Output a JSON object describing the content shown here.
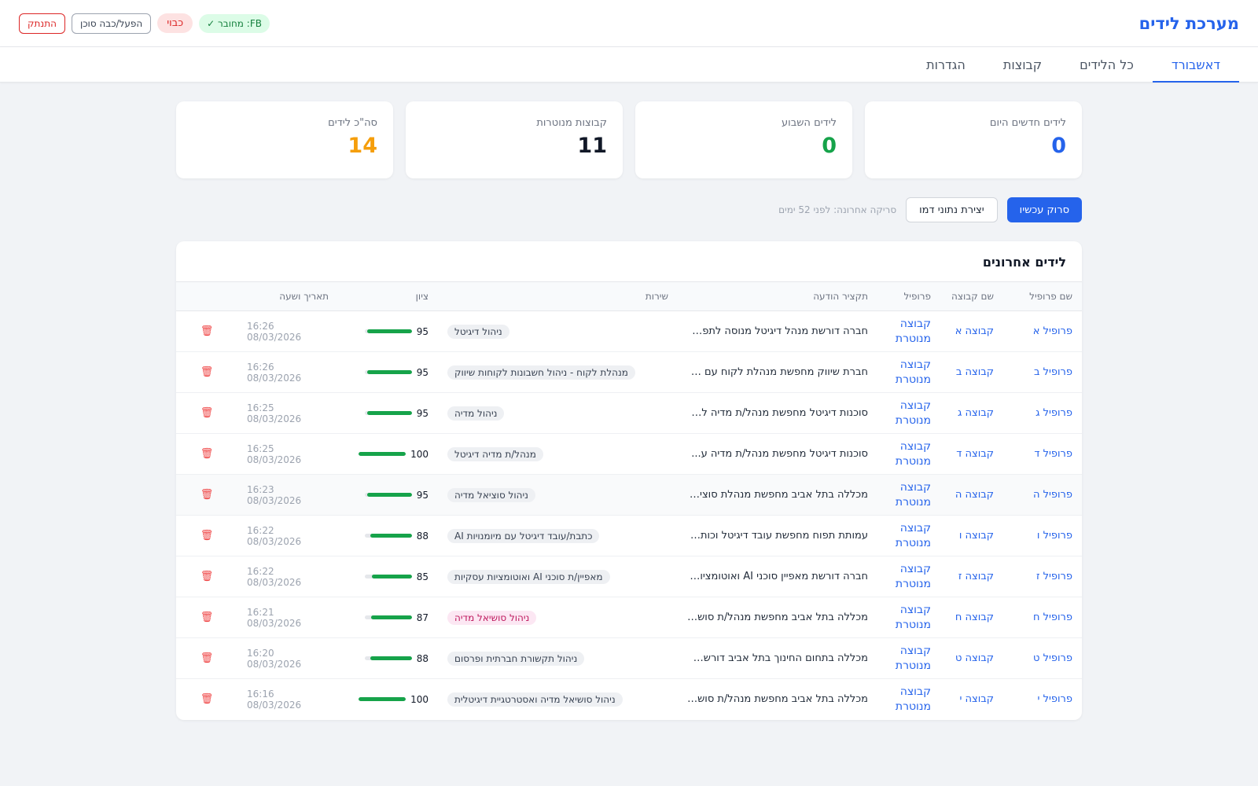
{
  "header": {
    "title": "מערכת לידים",
    "fb_status": "FB: מחובר ✓",
    "off_badge": "כבוי",
    "agent_toggle": "הפעל/כבה סוכן",
    "logout": "התנתק"
  },
  "tabs": [
    "דאשבורד",
    "כל הלידים",
    "קבוצות",
    "הגדרות"
  ],
  "stats": [
    {
      "label": "לידים חדשים היום",
      "value": "0",
      "color": "#2563eb"
    },
    {
      "label": "לידים השבוע",
      "value": "0",
      "color": "#16a34a"
    },
    {
      "label": "קבוצות מנוטרות",
      "value": "11",
      "color": "#111827"
    },
    {
      "label": "סה\"כ לידים",
      "value": "14",
      "color": "#f59e0b"
    }
  ],
  "actions": {
    "scan_now": "סרוק עכשיו",
    "create_demo": "יצירת נתוני דמו",
    "last_scan": "סריקה אחרונה: לפני 52 ימים"
  },
  "table": {
    "title": "לידים אחרונים",
    "columns": [
      "שם פרופיל",
      "שם קבוצה",
      "פרופיל",
      "תקציר הודעה",
      "שירות",
      "ציון",
      "תאריך ושעה"
    ],
    "rows": [
      {
        "profile": "פרופיל א",
        "group": "קבוצה א",
        "type": "קבוצה מנוטרת",
        "message": "חברה דורשת מנהל דיגיטל מנוסה לתפקי...",
        "service": "ניהול דיגיטל",
        "score": 95,
        "datetime": "16:26 08/03/2026"
      },
      {
        "profile": "פרופיל ב",
        "group": "קבוצה ב",
        "type": "קבוצה מנוטרת",
        "message": "חברת שיווק מחפשת מנהלת לקוח עם ני...",
        "service": "מנהלת לקוח - ניהול חשבונות לקוחות שיווק",
        "score": 95,
        "datetime": "16:26 08/03/2026"
      },
      {
        "profile": "פרופיל ג",
        "group": "קבוצה ג",
        "type": "קבוצה מנוטרת",
        "message": "סוכנות דיגיטל מחפשת מנהל/ת מדיה לת...",
        "service": "ניהול מדיה",
        "score": 95,
        "datetime": "16:25 08/03/2026"
      },
      {
        "profile": "פרופיל ד",
        "group": "קבוצה ד",
        "type": "קבוצה מנוטרת",
        "message": "סוכנות דיגיטל מחפשת מנהל/ת מדיה ע...",
        "service": "מנהל/ת מדיה דיגיטל",
        "score": 100,
        "datetime": "16:25 08/03/2026"
      },
      {
        "profile": "פרופיל ה",
        "group": "קבוצה ה",
        "type": "קבוצה מנוטרת",
        "message": "מכללה בתל אביב מחפשת מנהלת סוציא...",
        "service": "ניהול סוציאל מדיה",
        "score": 95,
        "datetime": "16:23 08/03/2026",
        "highlight": true
      },
      {
        "profile": "פרופיל ו",
        "group": "קבוצה ו",
        "type": "קבוצה מנוטרת",
        "message": "עמותת תפוח מחפשת עובד דיגיטל וכותב...",
        "service": "כתבת/עובד דיגיטל עם מיומנויות AI",
        "score": 88,
        "datetime": "16:22 08/03/2026"
      },
      {
        "profile": "פרופיל ז",
        "group": "קבוצה ז",
        "type": "קבוצה מנוטרת",
        "message": "חברה דורשת מאפיין סוכני AI ואוטומציות...",
        "service": "מאפיין/ת סוכני AI ואוטומציות עסקיות",
        "score": 85,
        "datetime": "16:22 08/03/2026"
      },
      {
        "profile": "פרופיל ח",
        "group": "קבוצה ח",
        "type": "קבוצה מנוטרת",
        "message": "מכללה בתל אביב מחפשת מנהל/ת סושי...",
        "service": "ניהול סושיאל מדיה",
        "score": 87,
        "datetime": "16:21 08/03/2026",
        "pink": true
      },
      {
        "profile": "פרופיל ט",
        "group": "קבוצה ט",
        "type": "קבוצה מנוטרת",
        "message": "מכללה בתחום החינוך בתל אביב דורשת ...",
        "service": "ניהול תקשורת חברתית ופרסום",
        "score": 88,
        "datetime": "16:20 08/03/2026"
      },
      {
        "profile": "פרופיל י",
        "group": "קבוצה י",
        "type": "קבוצה מנוטרת",
        "message": "מכללה בתל אביב מחפשת מנהל/ת סושי...",
        "service": "ניהול סושיאל מדיה ואסטרטגיית דיגיטלית",
        "score": 100,
        "datetime": "16:16 08/03/2026"
      }
    ]
  },
  "icons": {
    "delete": "trash-icon"
  }
}
